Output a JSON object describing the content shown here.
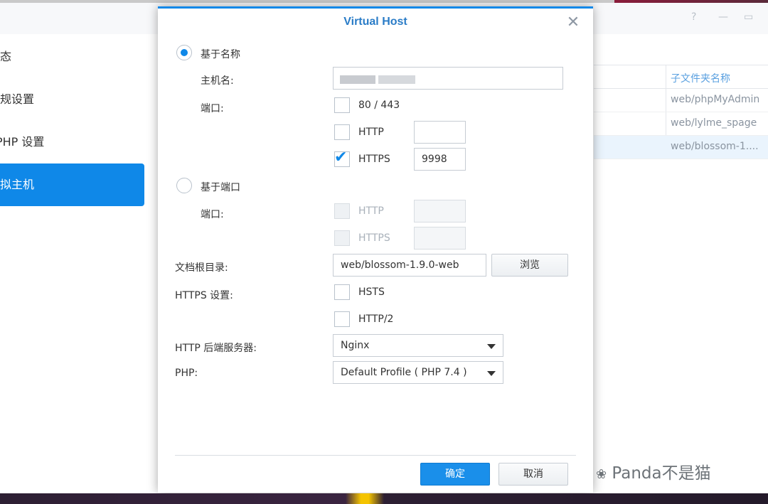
{
  "background": {
    "sidebar": [
      {
        "label": "状态",
        "active": false
      },
      {
        "label": "常规设置",
        "active": false
      },
      {
        "label": "PHP 设置",
        "active": false
      },
      {
        "label": "虚拟主机",
        "active": true
      }
    ],
    "list": {
      "column_header": "子文件夹名称",
      "rows": [
        "web/phpMyAdmin",
        "web/lylme_spage",
        "web/blossom-1...."
      ]
    },
    "window_controls": [
      "?",
      "—",
      "▭"
    ]
  },
  "dialog": {
    "title": "Virtual Host",
    "close_symbol": "✕",
    "name_based": {
      "radio_label": "基于名称",
      "selected": true,
      "hostname_label": "主机名:",
      "hostname_value": "",
      "port_label": "端口:",
      "ports": [
        {
          "label": "80 / 443",
          "checked": false
        },
        {
          "label": "HTTP",
          "checked": false,
          "value": ""
        },
        {
          "label": "HTTPS",
          "checked": true,
          "value": "9998"
        }
      ]
    },
    "port_based": {
      "radio_label": "基于端口",
      "selected": false,
      "port_label": "端口:",
      "ports": [
        {
          "label": "HTTP",
          "value": ""
        },
        {
          "label": "HTTPS",
          "value": ""
        }
      ]
    },
    "doc_root": {
      "label": "文档根目录:",
      "value": "web/blossom-1.9.0-web",
      "browse_label": "浏览"
    },
    "https_settings": {
      "label": "HTTPS 设置:",
      "options": [
        {
          "label": "HSTS",
          "checked": false
        },
        {
          "label": "HTTP/2",
          "checked": false
        }
      ]
    },
    "backend": {
      "label": "HTTP 后端服务器:",
      "selected": "Nginx"
    },
    "php": {
      "label": "PHP:",
      "selected": "Default Profile ( PHP 7.4 )"
    },
    "buttons": {
      "ok": "确定",
      "cancel": "取消"
    }
  },
  "watermark": "Panda不是猫",
  "colors": {
    "accent": "#0f88e8",
    "title": "#2a7cc7"
  }
}
